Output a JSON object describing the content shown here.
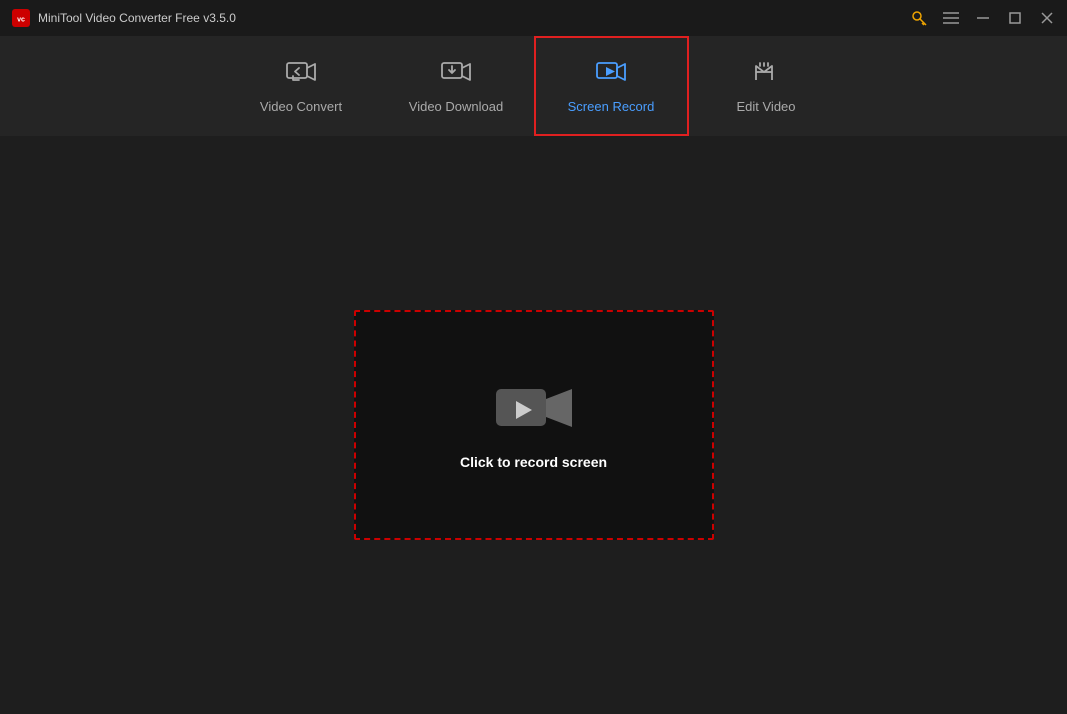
{
  "titlebar": {
    "app_name": "MiniTool Video Converter Free v3.5.0",
    "logo_text": "vc"
  },
  "nav": {
    "tabs": [
      {
        "id": "video-convert",
        "label": "Video Convert",
        "active": false
      },
      {
        "id": "video-download",
        "label": "Video Download",
        "active": false
      },
      {
        "id": "screen-record",
        "label": "Screen Record",
        "active": true
      },
      {
        "id": "edit-video",
        "label": "Edit Video",
        "active": false
      }
    ]
  },
  "main": {
    "record_prompt": "Click to record screen"
  },
  "colors": {
    "active_border": "#e02020",
    "active_text": "#4a9eff",
    "inactive_text": "#aaaaaa",
    "record_border": "#cc0000"
  }
}
